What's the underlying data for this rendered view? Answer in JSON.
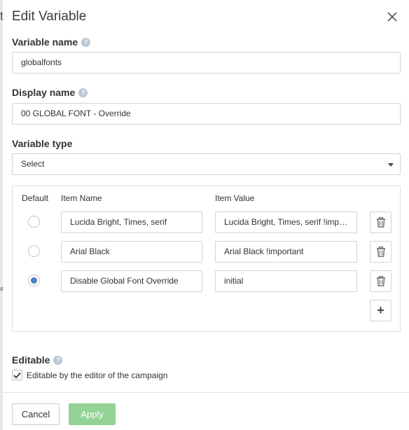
{
  "dialog": {
    "title": "Edit Variable",
    "help_glyph": "?"
  },
  "fields": {
    "variable_name": {
      "label": "Variable name",
      "value": "globalfonts"
    },
    "display_name": {
      "label": "Display name",
      "value": "00 GLOBAL FONT - Override"
    },
    "variable_type": {
      "label": "Variable type",
      "value": "Select"
    }
  },
  "items_table": {
    "headers": {
      "default": "Default",
      "item_name": "Item Name",
      "item_value": "Item Value"
    },
    "rows": [
      {
        "name": "Lucida Bright, Times, serif",
        "value": "Lucida Bright, Times, serif !important",
        "default": false
      },
      {
        "name": "Arial Black",
        "value": "Arial Black !important",
        "default": false
      },
      {
        "name": "Disable Global Font Override",
        "value": "initial",
        "default": true
      }
    ],
    "add_glyph": "+"
  },
  "editable": {
    "label": "Editable",
    "checkbox_label": "Editable by the editor of the campaign",
    "checked": true
  },
  "footer": {
    "cancel_label": "Cancel",
    "apply_label": "Apply"
  },
  "backdrop": {
    "glyphs": [
      "t",
      "a"
    ]
  },
  "colors": {
    "apply_button": "#93d395",
    "radio_selected": "#4a7fc1",
    "help_icon": "#b9c7d6"
  }
}
